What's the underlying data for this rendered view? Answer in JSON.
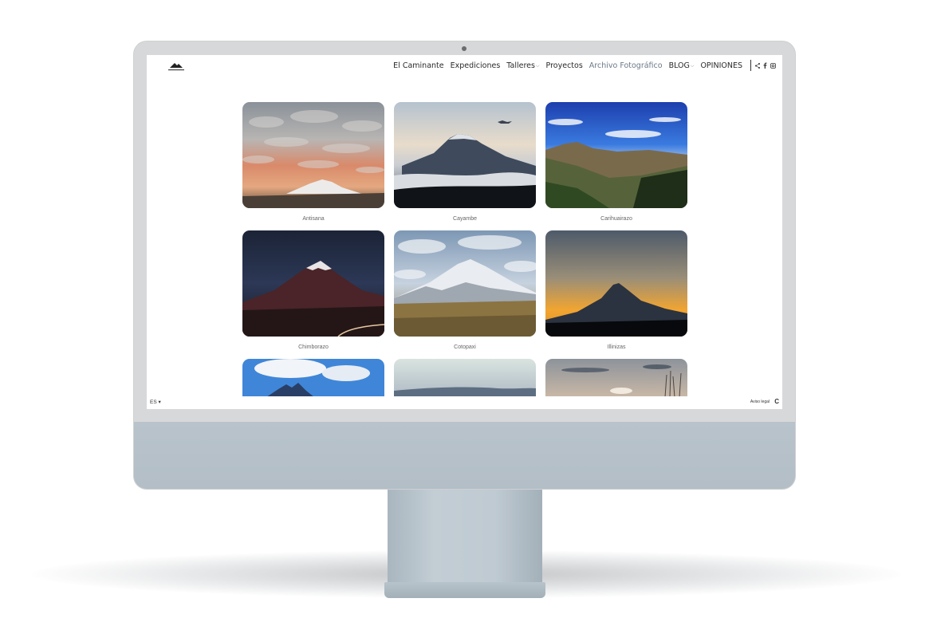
{
  "nav": {
    "items": [
      {
        "label": "El Caminante",
        "dropdown": false,
        "active": false
      },
      {
        "label": "Expediciones",
        "dropdown": false,
        "active": false
      },
      {
        "label": "Talleres",
        "dropdown": true,
        "active": false
      },
      {
        "label": "Proyectos",
        "dropdown": false,
        "active": false
      },
      {
        "label": "Archivo Fotográfico",
        "dropdown": false,
        "active": true
      },
      {
        "label": "BLOG",
        "dropdown": true,
        "active": false
      },
      {
        "label": "OPINIONES",
        "dropdown": false,
        "active": false
      }
    ],
    "caret": "⌵",
    "social_icons": [
      "share-icon",
      "facebook-icon",
      "instagram-icon"
    ]
  },
  "gallery": {
    "items": [
      {
        "caption": "Antisana"
      },
      {
        "caption": "Cayambe"
      },
      {
        "caption": "Carihuairazo"
      },
      {
        "caption": "Chimborazo"
      },
      {
        "caption": "Cotopaxi"
      },
      {
        "caption": "Illinizas"
      }
    ]
  },
  "footer": {
    "language": "ES ▾",
    "legal_link": "Aviso legal",
    "brand_glyph": "C"
  },
  "colors": {
    "active_nav": "#6b7a8a",
    "monitor_chin": "#b8c3cb"
  }
}
